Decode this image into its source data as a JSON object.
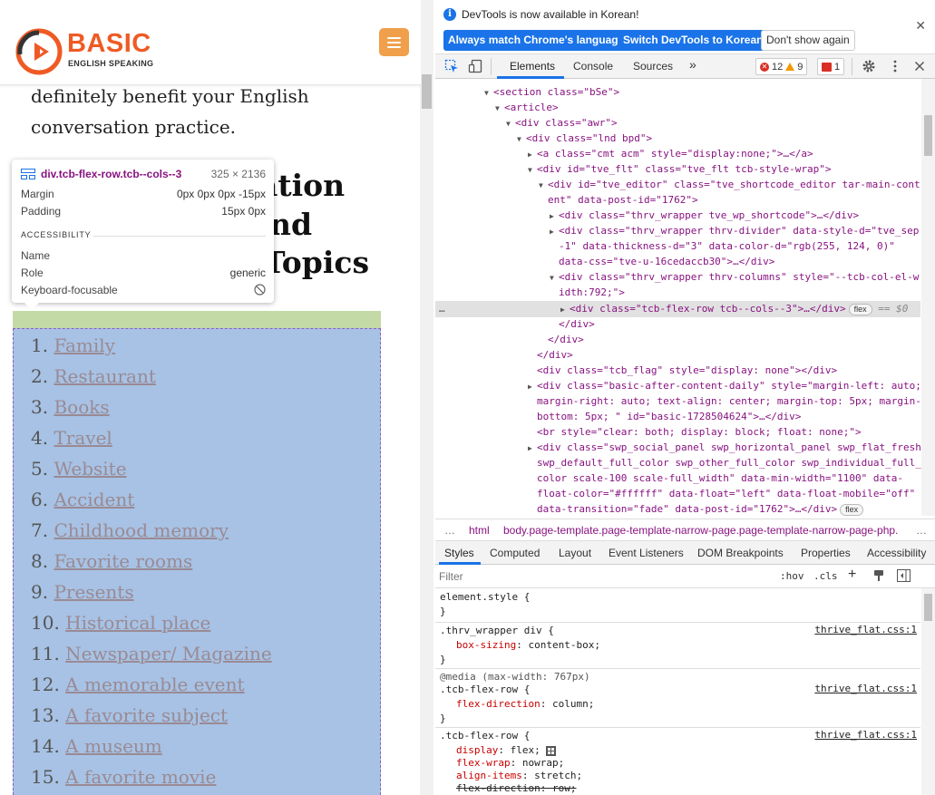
{
  "website": {
    "logo": {
      "word": "BASIC",
      "tagline": "ENGLISH SPEAKING"
    },
    "intro_lines": [
      "definitely benefit your English",
      "conversation practice."
    ],
    "headline_fragments": [
      "ation",
      "nd",
      "Topics"
    ],
    "topics": [
      {
        "num": "1.",
        "label": "Family"
      },
      {
        "num": "2.",
        "label": "Restaurant"
      },
      {
        "num": "3.",
        "label": "Books"
      },
      {
        "num": "4.",
        "label": "Travel"
      },
      {
        "num": "5.",
        "label": "Website"
      },
      {
        "num": "6.",
        "label": "Accident"
      },
      {
        "num": "7.",
        "label": "Childhood memory"
      },
      {
        "num": "8.",
        "label": "Favorite rooms"
      },
      {
        "num": "9.",
        "label": "Presents"
      },
      {
        "num": "10.",
        "label": "Historical place"
      },
      {
        "num": "11.",
        "label": "Newspaper/ Magazine"
      },
      {
        "num": "12.",
        "label": "A memorable event"
      },
      {
        "num": "13.",
        "label": "A favorite subject"
      },
      {
        "num": "14.",
        "label": "A museum"
      },
      {
        "num": "15.",
        "label": "A favorite movie"
      }
    ]
  },
  "tooltip": {
    "selector": "div.tcb-flex-row.tcb--cols--3",
    "dimensions": "325 × 2136",
    "margin_label": "Margin",
    "margin_value": "0px 0px 0px -15px",
    "padding_label": "Padding",
    "padding_value": "15px 0px",
    "accessibility_heading": "ACCESSIBILITY",
    "name_label": "Name",
    "role_label": "Role",
    "role_value": "generic",
    "focusable_label": "Keyboard-focusable"
  },
  "devtools": {
    "infobar": {
      "message": "DevTools is now available in Korean!",
      "btn_match": "Always match Chrome's language",
      "btn_switch": "Switch DevTools to Korean",
      "btn_dismiss": "Don't show again"
    },
    "tabs": {
      "elements": "Elements",
      "console": "Console",
      "sources": "Sources",
      "more": "»"
    },
    "counts": {
      "errors": "12",
      "warnings": "9",
      "issues": "1"
    },
    "dom_lines": [
      "<section class=\"bSe\">",
      "<article>",
      "<div class=\"awr\">",
      "<div class=\"lnd bpd\">",
      "<a class=\"cmt acm\" style=\"display:none;\">…</a>",
      "<div id=\"tve_flt\" class=\"tve_flt tcb-style-wrap\">",
      "<div id=\"tve_editor\" class=\"tve_shortcode_editor tar-main-cont",
      "ent\" data-post-id=\"1762\">",
      "<div class=\"thrv_wrapper tve_wp_shortcode\">…</div>",
      "<div class=\"thrv_wrapper thrv-divider\" data-style-d=\"tve_sep",
      "-1\" data-thickness-d=\"3\" data-color-d=\"rgb(255, 124, 0)\"",
      "data-css=\"tve-u-16cedaccb30\">…</div>",
      "<div class=\"thrv_wrapper thrv-columns\" style=\"--tcb-col-el-w",
      "idth:792;\">",
      "<div class=\"tcb-flex-row tcb--cols--3\">…</div>",
      "</div>",
      "</div>",
      "</div>",
      "<div class=\"tcb_flag\" style=\"display: none\"></div>",
      "<div class=\"basic-after-content-daily\" style=\"margin-left: auto;",
      "margin-right: auto; text-align: center; margin-top: 5px; margin-",
      "bottom: 5px; \" id=\"basic-1728504624\">…</div>",
      "<br style=\"clear: both; display: block; float: none;\">",
      "<div class=\"swp_social_panel swp_horizontal_panel swp_flat_fresh",
      "swp_default_full_color swp_other_full_color swp_individual_full_",
      "color scale-100 scale-full_width\" data-min-width=\"1100\" data-",
      "float-color=\"#ffffff\" data-float=\"left\" data-float-mobile=\"off\"",
      "data-transition=\"fade\" data-post-id=\"1762\">…</div>"
    ],
    "flex_badge": "flex",
    "selected_marker": "== $0",
    "dots": "…",
    "breadcrumb": {
      "ellipsis": "…",
      "html": "html",
      "body": "body.page-template.page-template-narrow-page.page-template-narrow-page-php.",
      "more": "…"
    },
    "subtabs": [
      "Styles",
      "Computed",
      "Layout",
      "Event Listeners",
      "DOM Breakpoints",
      "Properties",
      "Accessibility"
    ],
    "filter_placeholder": "Filter",
    "hov": ":hov",
    "cls": ".cls",
    "plus": "+",
    "styles": {
      "element_style": "element.style {",
      "close": "}",
      "rule1_selector": ".thrv_wrapper div {",
      "rule1_source": "thrive_flat.css:1",
      "rule1_prop": "box-sizing",
      "rule1_val": "content-box;",
      "media": "@media (max-width: 767px)",
      "rule2_selector": ".tcb-flex-row {",
      "rule2_source": "thrive_flat.css:1",
      "rule2_prop": "flex-direction",
      "rule2_val": "column;",
      "rule3_selector": ".tcb-flex-row {",
      "rule3_source": "thrive_flat.css:1",
      "rule3_props": [
        {
          "name": "display",
          "value": "flex;"
        },
        {
          "name": "flex-wrap",
          "value": "nowrap;"
        },
        {
          "name": "align-items",
          "value": "stretch;"
        },
        {
          "name": "flex-direction",
          "value": "row;"
        }
      ]
    }
  }
}
